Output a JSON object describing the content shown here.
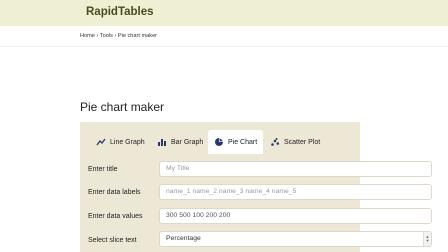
{
  "brand": "RapidTables",
  "breadcrumb": {
    "items": [
      "Home",
      "Tools",
      "Pie chart maker"
    ],
    "separator": "›"
  },
  "page": {
    "title": "Pie chart maker"
  },
  "tabs": [
    {
      "label": "Line Graph",
      "icon": "line-graph-icon",
      "active": false
    },
    {
      "label": "Bar Graph",
      "icon": "bar-graph-icon",
      "active": false
    },
    {
      "label": "Pie Chart",
      "icon": "pie-chart-icon",
      "active": true
    },
    {
      "label": "Scatter Plot",
      "icon": "scatter-plot-icon",
      "active": false
    }
  ],
  "form": {
    "title": {
      "label": "Enter title",
      "placeholder": "My Title",
      "value": ""
    },
    "labels": {
      "label": "Enter data labels",
      "placeholder": "name_1 name_2 name_3 name_4 name_5",
      "value": ""
    },
    "values": {
      "label": "Enter data values",
      "placeholder": "",
      "value": "300 500 100 200 200"
    },
    "slice_text": {
      "label": "Select slice text",
      "selected": "Percentage"
    }
  },
  "colors": {
    "topbar": "#efefd4",
    "brand": "#4a4b1e",
    "panel": "#ede7d6",
    "accent": "#2a3b6b"
  }
}
